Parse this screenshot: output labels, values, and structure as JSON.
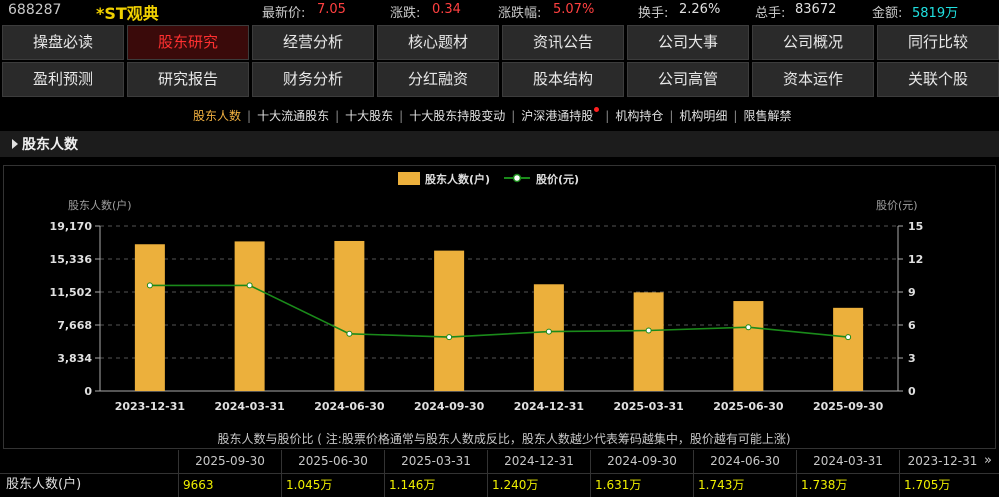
{
  "quote": {
    "code": "688287",
    "name": "*ST观典",
    "latest_label": "最新价:",
    "latest_value": "7.05",
    "change_label": "涨跌:",
    "change_value": "0.34",
    "change_pct_label": "涨跌幅:",
    "change_pct_value": "5.07%",
    "turnover_label": "换手:",
    "turnover_value": "2.26%",
    "volume_label": "总手:",
    "volume_value": "83672",
    "amount_label": "金额:",
    "amount_value": "5819万"
  },
  "nav": {
    "row1": [
      "操盘必读",
      "股东研究",
      "经营分析",
      "核心题材",
      "资讯公告",
      "公司大事",
      "公司概况",
      "同行比较"
    ],
    "row2": [
      "盈利预测",
      "研究报告",
      "财务分析",
      "分红融资",
      "股本结构",
      "公司高管",
      "资本运作",
      "关联个股"
    ],
    "active": "股东研究"
  },
  "subnav": {
    "items": [
      "股东人数",
      "十大流通股东",
      "十大股东",
      "十大股东持股变动",
      "沪深港通持股",
      "机构持仓",
      "机构明细",
      "限售解禁"
    ],
    "active": "股东人数"
  },
  "section": {
    "title": "股东人数"
  },
  "chart_data": {
    "type": "bar",
    "legend": [
      "股东人数(户)",
      "股价(元)"
    ],
    "left_axis_title": "股东人数(户)",
    "right_axis_title": "股价(元)",
    "categories": [
      "2023-12-31",
      "2024-03-31",
      "2024-06-30",
      "2024-09-30",
      "2024-12-31",
      "2025-03-31",
      "2025-06-30",
      "2025-09-30"
    ],
    "series": [
      {
        "name": "股东人数(户)",
        "type": "bar",
        "axis": "left",
        "values": [
          17050,
          17380,
          17430,
          16310,
          12400,
          11460,
          10450,
          9663
        ]
      },
      {
        "name": "股价(元)",
        "type": "line",
        "axis": "right",
        "values": [
          9.6,
          9.6,
          5.2,
          4.9,
          5.4,
          5.5,
          5.8,
          4.9
        ]
      }
    ],
    "left_ticks": [
      "0",
      "3,834",
      "7,668",
      "11,502",
      "15,336",
      "19,170"
    ],
    "right_ticks": [
      "0",
      "3",
      "6",
      "9",
      "12",
      "15"
    ],
    "ylim_left": [
      0,
      19170
    ],
    "ylim_right": [
      0,
      15
    ],
    "grid": true,
    "legend_position": "top-center",
    "colors": {
      "bar": "#ecb03c",
      "line": "#1a8a1a",
      "marker_fill": "#ffffff"
    },
    "note": "股东人数与股价比 ( 注:股票价格通常与股东人数成反比，股东人数越少代表筹码越集中，股价越有可能上涨)"
  },
  "table": {
    "headers": [
      "2025-09-30",
      "2025-06-30",
      "2025-03-31",
      "2024-12-31",
      "2024-09-30",
      "2024-06-30",
      "2024-03-31",
      "2023-12-31"
    ],
    "row_label": "股东人数(户)",
    "values": [
      "9663",
      "1.045万",
      "1.146万",
      "1.240万",
      "1.631万",
      "1.743万",
      "1.738万",
      "1.705万"
    ],
    "more": "»"
  }
}
